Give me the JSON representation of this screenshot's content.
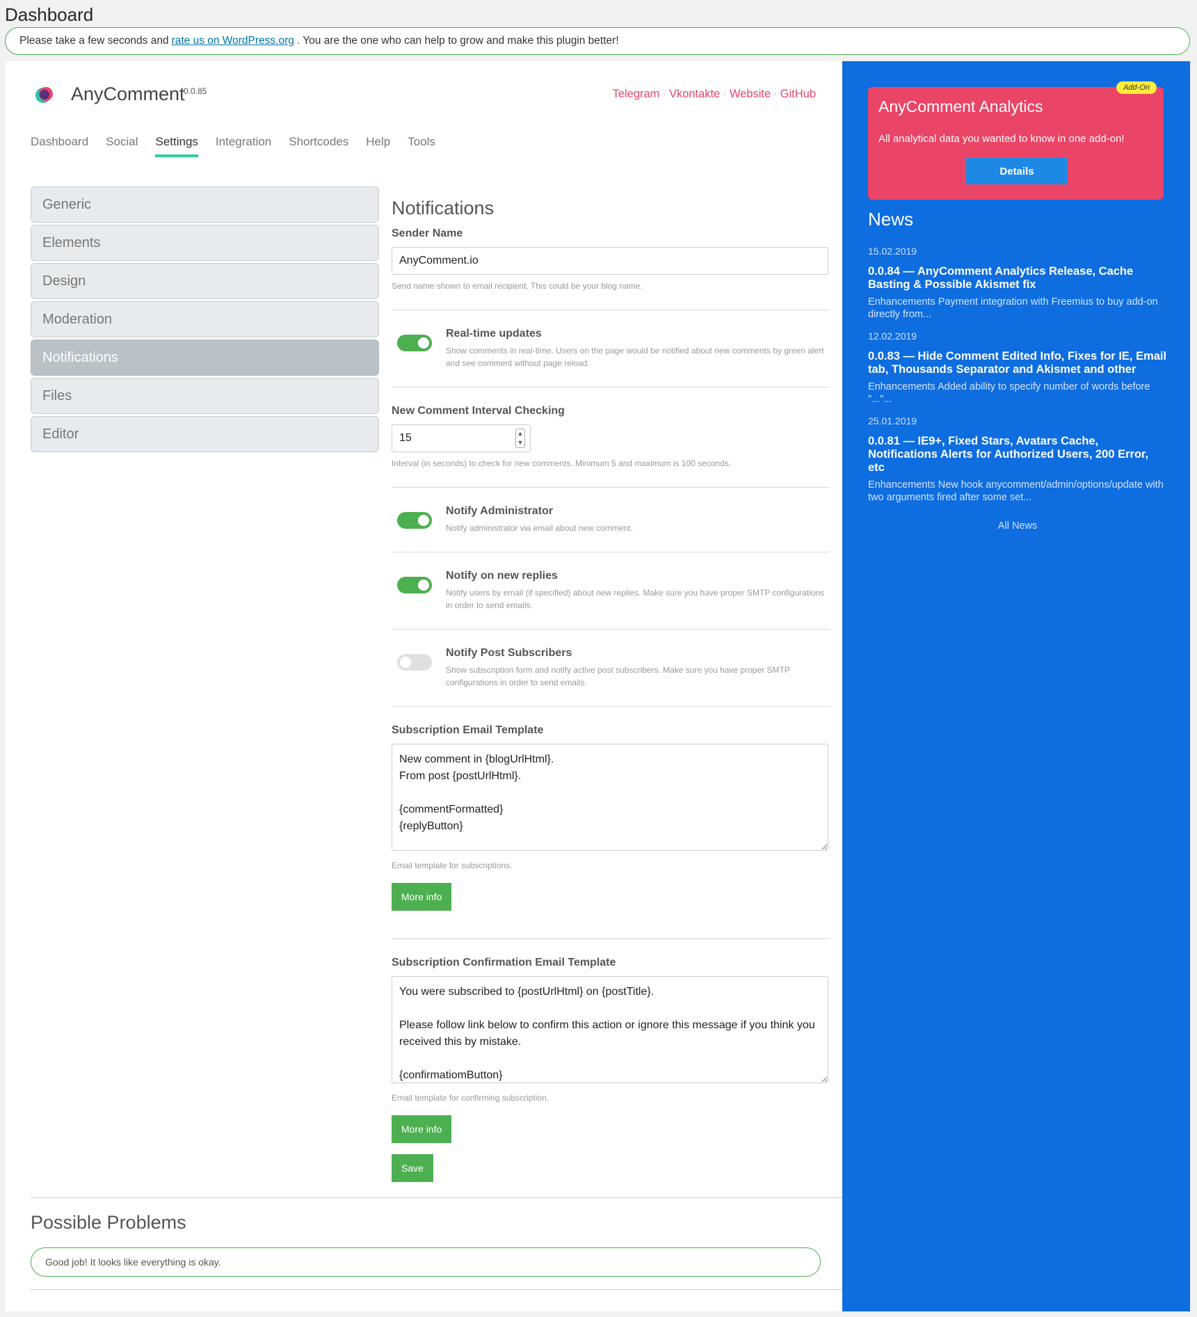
{
  "page": {
    "title": "Dashboard"
  },
  "notice": {
    "text_before": "Please take a few seconds and",
    "link_text": "rate us on WordPress.org",
    "text_after": ". You are the one who can help to grow and make this plugin better!"
  },
  "header": {
    "brand": "AnyComment",
    "version": "0.0.85",
    "links": [
      "Telegram",
      "Vkontakte",
      "Website",
      "GitHub"
    ]
  },
  "tabs": [
    "Dashboard",
    "Social",
    "Settings",
    "Integration",
    "Shortcodes",
    "Help",
    "Tools"
  ],
  "active_tab": "Settings",
  "settings_menu": [
    "Generic",
    "Elements",
    "Design",
    "Moderation",
    "Notifications",
    "Files",
    "Editor"
  ],
  "active_menu": "Notifications",
  "form": {
    "title": "Notifications",
    "sender_name": {
      "label": "Sender Name",
      "value": "AnyComment.io",
      "hint": "Send name shown to email recipient. This could be your blog name."
    },
    "realtime": {
      "title": "Real-time updates",
      "desc": "Show comments in real-time. Users on the page would be notified about new comments by green alert and see comment without page reload.",
      "on": true
    },
    "interval": {
      "label": "New Comment Interval Checking",
      "value": "15",
      "hint": "Interval (in seconds) to check for new comments. Minimum 5 and maximum is 100 seconds."
    },
    "notify_admin": {
      "title": "Notify Administrator",
      "desc": "Notify administrator via email about new comment.",
      "on": true
    },
    "notify_replies": {
      "title": "Notify on new replies",
      "desc": "Notify users by email (if specified) about new replies. Make sure you have proper SMTP configurations in order to send emails.",
      "on": true
    },
    "notify_subscribers": {
      "title": "Notify Post Subscribers",
      "desc": "Show subscription form and notify active post subscribers. Make sure you have proper SMTP configurations in order to send emails.",
      "on": false
    },
    "sub_template": {
      "label": "Subscription Email Template",
      "value": "New comment in {blogUrlHtml}.\nFrom post {postUrlHtml}.\n\n{commentFormatted}\n{replyButton}",
      "hint": "Email template for subscriptions.",
      "button": "More info"
    },
    "confirm_template": {
      "label": "Subscription Confirmation Email Template",
      "value": "You were subscribed to {postUrlHtml} on {postTitle}.\n\nPlease follow link below to confirm this action or ignore this message if you think you received this by mistake.\n\n{confirmatiomButton}",
      "hint": "Email template for confirming subscription.",
      "button": "More info"
    },
    "save": "Save"
  },
  "problems": {
    "title": "Possible Problems",
    "message": "Good job! It looks like everything is okay."
  },
  "addon": {
    "badge": "Add-On",
    "title": "AnyComment Analytics",
    "desc": "All analytical data you wanted to know in one add-on!",
    "button": "Details"
  },
  "news": {
    "title": "News",
    "items": [
      {
        "date": "15.02.2019",
        "title": "0.0.84 — AnyComment Analytics Release, Cache Basting & Possible Akismet fix",
        "desc": "Enhancements Payment integration with Freemius to buy add-on directly from..."
      },
      {
        "date": "12.02.2019",
        "title": "0.0.83 — Hide Comment Edited Info, Fixes for IE, Email tab, Thousands Separator and Akismet and other",
        "desc": "Enhancements Added ability to specify number of words before \"...\"..."
      },
      {
        "date": "25.01.2019",
        "title": "0.0.81 — IE9+, Fixed Stars, Avatars Cache, Notifications Alerts for Authorized Users, 200 Error, etc",
        "desc": "Enhancements New hook anycomment/admin/options/update with two arguments fired after some set..."
      }
    ],
    "all_news": "All News"
  },
  "colors": {
    "accent_green": "#4caf50",
    "tab_underline": "#2fcf9a",
    "sidebar_blue": "#0e6ddf",
    "addon_pink": "#ea4466",
    "link_pink": "#e8456c"
  }
}
